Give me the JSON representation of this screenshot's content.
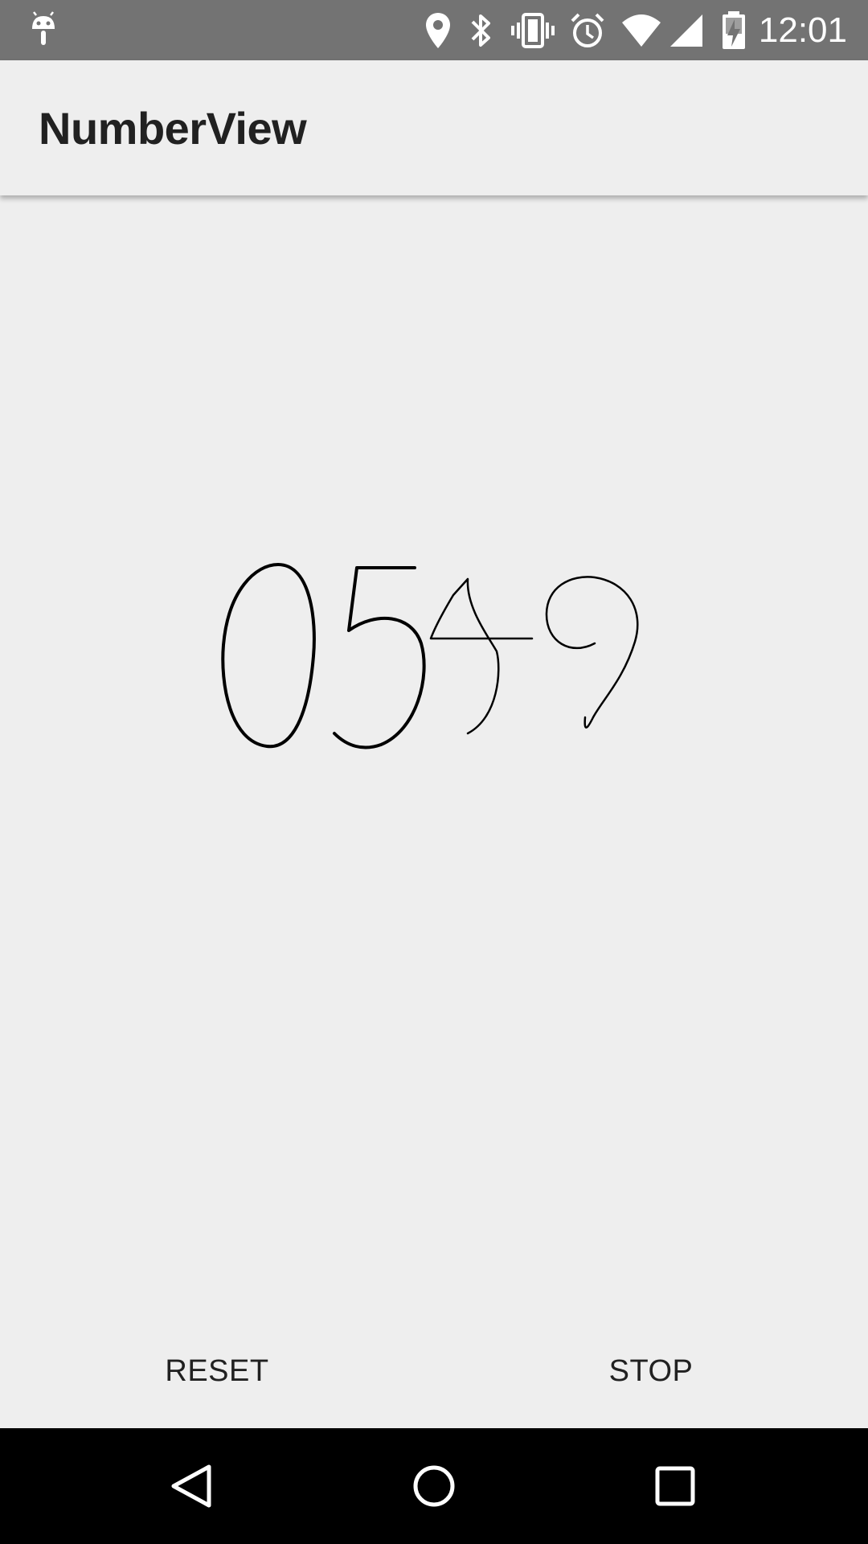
{
  "status_bar": {
    "time": "12:01",
    "icons": [
      "android-debug-icon",
      "location-pin-icon",
      "bluetooth-icon",
      "vibrate-icon",
      "alarm-icon",
      "wifi-icon",
      "cell-signal-icon",
      "battery-charging-icon"
    ]
  },
  "app_bar": {
    "title": "NumberView"
  },
  "number_view": {
    "digits": "0549"
  },
  "buttons": {
    "reset_label": "RESET",
    "stop_label": "STOP"
  },
  "nav_bar": {
    "icons": [
      "back-icon",
      "home-icon",
      "recents-icon"
    ]
  },
  "colors": {
    "status_bar": "#737373",
    "app_bar": "#eeeeee",
    "background": "#eeeeee",
    "text": "#212121",
    "nav_bar": "#000000"
  }
}
